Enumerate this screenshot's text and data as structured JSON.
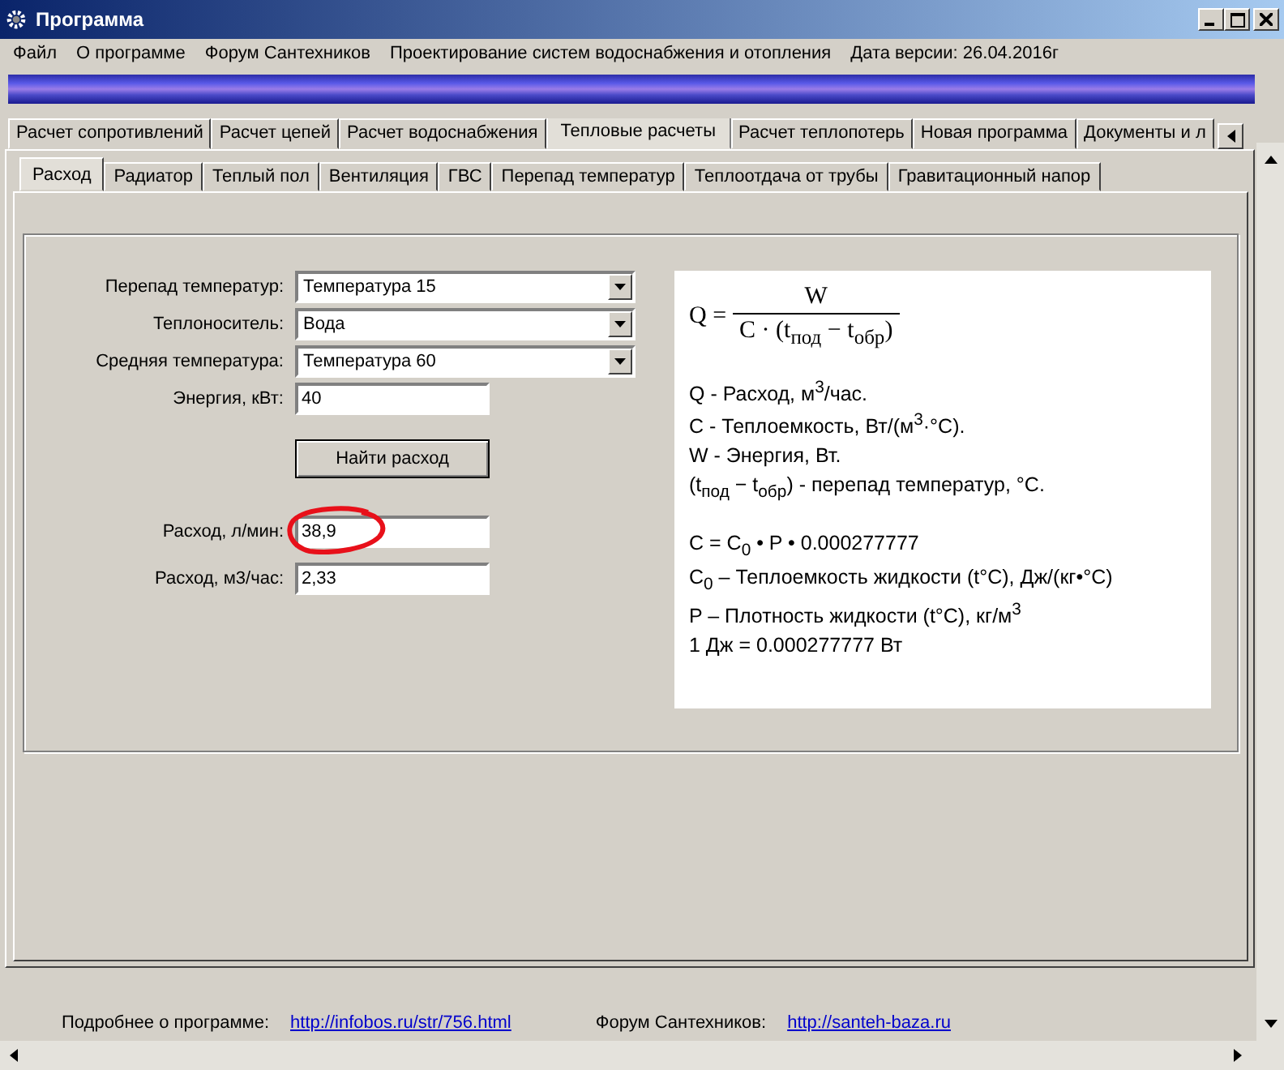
{
  "window": {
    "title": "Программа"
  },
  "menu": [
    {
      "label": "Файл"
    },
    {
      "label": "О программе"
    },
    {
      "label": "Форум Сантехников"
    },
    {
      "label": "Проектирование систем водоснабжения и отопления"
    },
    {
      "label": "Дата версии: 26.04.2016г"
    }
  ],
  "tabs": [
    {
      "label": "Расчет сопротивлений",
      "selected": false
    },
    {
      "label": "Расчет цепей",
      "selected": false
    },
    {
      "label": "Расчет водоснабжения",
      "selected": false
    },
    {
      "label": "Тепловые расчеты",
      "selected": true
    },
    {
      "label": "Расчет теплопотерь",
      "selected": false
    },
    {
      "label": "Новая программа",
      "selected": false
    },
    {
      "label": "Документы и л",
      "selected": false
    }
  ],
  "subtabs": [
    {
      "label": "Расход",
      "selected": true
    },
    {
      "label": "Радиатор",
      "selected": false
    },
    {
      "label": "Теплый пол",
      "selected": false
    },
    {
      "label": "Вентиляция",
      "selected": false
    },
    {
      "label": "ГВС",
      "selected": false
    },
    {
      "label": "Перепад температур",
      "selected": false
    },
    {
      "label": "Теплоотдача от трубы",
      "selected": false
    },
    {
      "label": "Гравитационный напор",
      "selected": false
    }
  ],
  "form": [
    {
      "kind": "dropdown",
      "label": "Перепад температур:",
      "value": "Температура 15"
    },
    {
      "kind": "dropdown",
      "label": "Теплоноситель:",
      "value": "Вода"
    },
    {
      "kind": "dropdown",
      "label": "Средняя температура:",
      "value": "Температура 60"
    },
    {
      "kind": "input",
      "label": "Энергия, кВт:",
      "value": "40"
    },
    {
      "kind": "button",
      "label": "Найти расход"
    },
    {
      "kind": "input",
      "label": "Расход, л/мин:",
      "value": "38,9",
      "circled": true
    },
    {
      "kind": "input",
      "label": "Расход, м3/час:",
      "value": "2,33",
      "circled": false
    }
  ],
  "formula": {
    "lhs": "Q =",
    "numerator": "W",
    "denominator": "C · (t$_{под}$ − t$_{обр}$)",
    "lines": [
      {
        "text": "Q - Расход, м$^{3}$/час."
      },
      {
        "text": "C - Теплоемкость, Вт/(м$^{3}$·°C)."
      },
      {
        "text": "W - Энергия, Вт."
      },
      {
        "text": "(t$_{под}$ − t$_{обр}$) - перепад температур, °C."
      }
    ],
    "lines2": [
      {
        "text": "C = C$_{0}$ • P • 0.000277777"
      },
      {
        "text": "C$_{0}$ – Теплоемкость жидкости (t°C), Дж/(кг•°C)"
      },
      {
        "text": "P – Плотность жидкости (t°C), кг/м$^{3}$"
      },
      {
        "text": "1 Дж = 0.000277777 Вт"
      }
    ]
  },
  "footer": [
    {
      "label": "Подробнее о программе:",
      "link": "http://infobos.ru/str/756.html"
    },
    {
      "label": "Форум Сантехников:",
      "link": "http://santeh-baza.ru"
    }
  ]
}
